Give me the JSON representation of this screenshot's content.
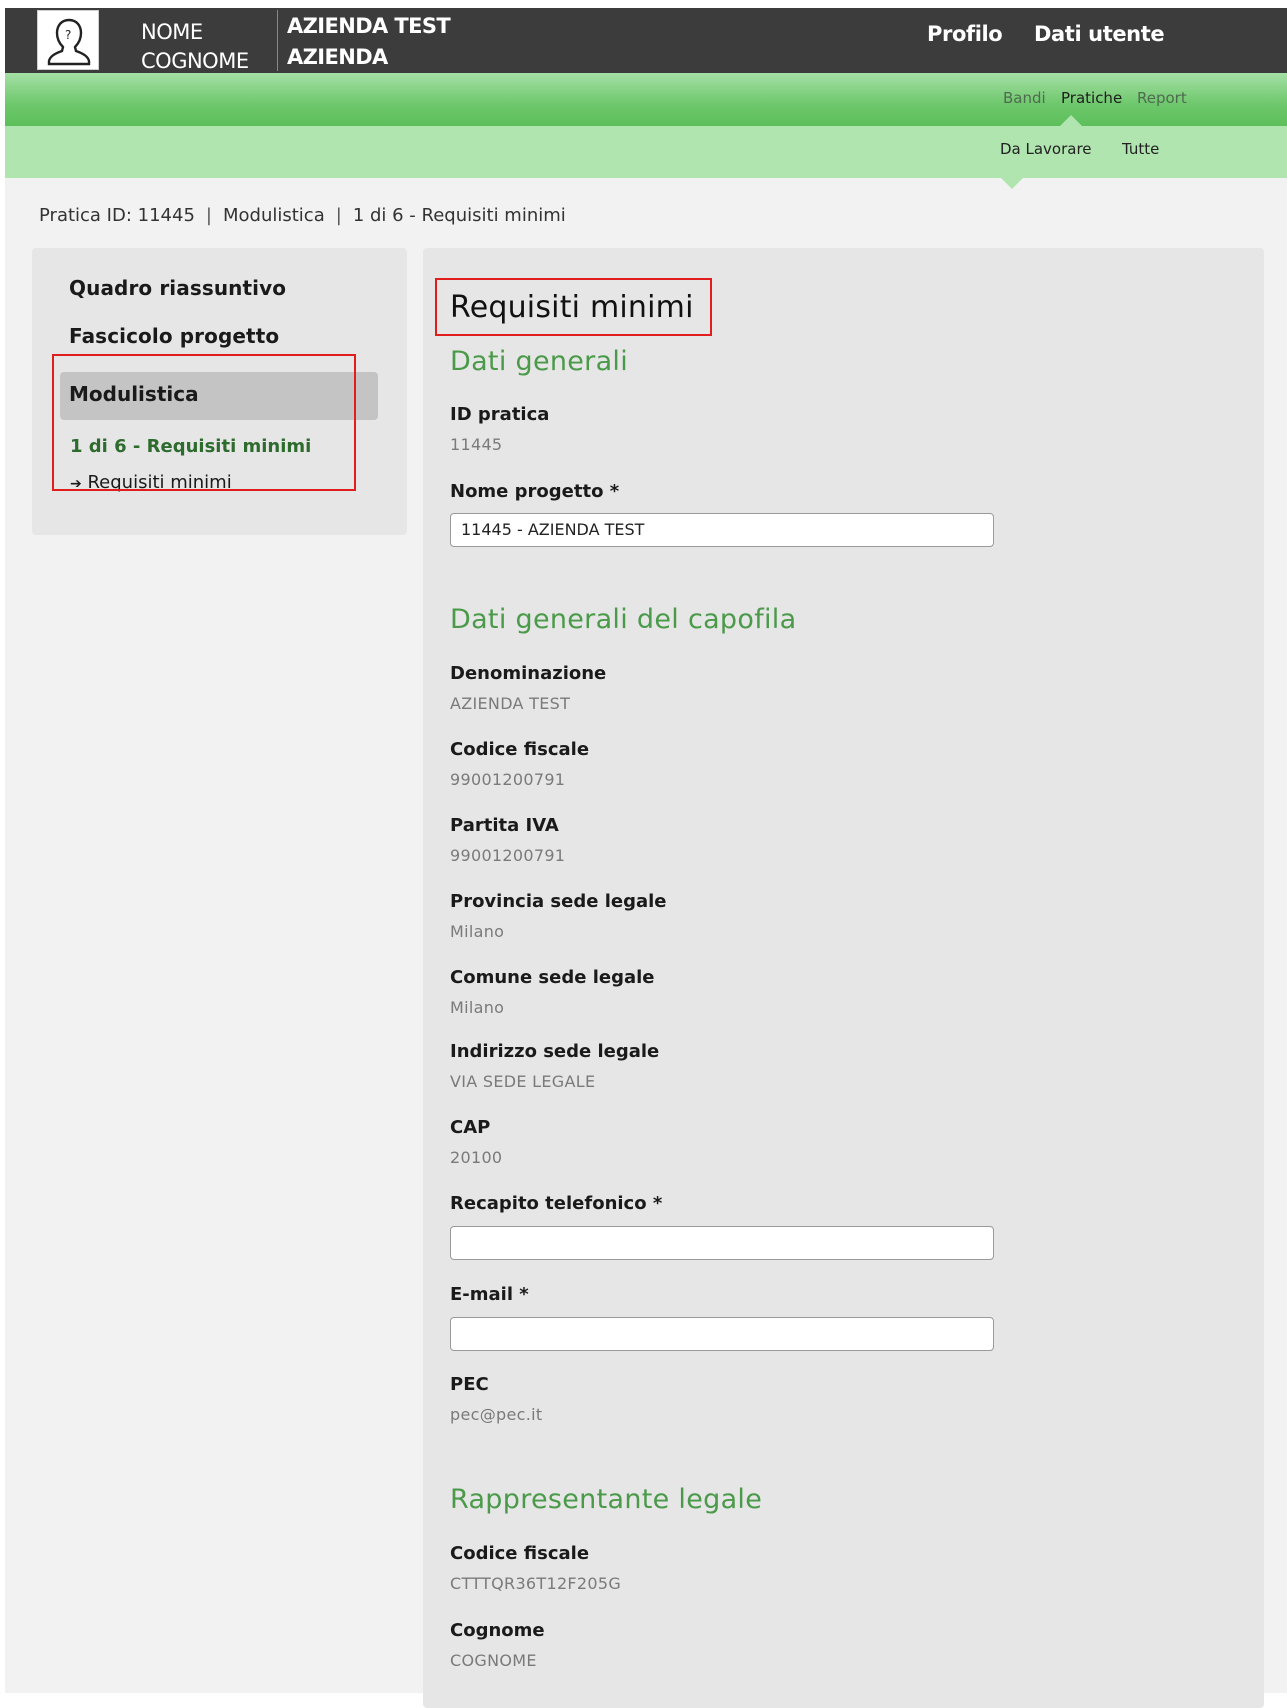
{
  "header": {
    "user_first": "NOME",
    "user_last": "COGNOME",
    "company_line1": "AZIENDA TEST",
    "company_line2": "AZIENDA",
    "profilo": "Profilo",
    "dati_utente": "Dati utente"
  },
  "nav": {
    "primary": [
      "Bandi",
      "Pratiche",
      "Report"
    ],
    "primary_active": "Pratiche",
    "secondary": [
      "Da Lavorare",
      "Tutte"
    ]
  },
  "breadcrumb": {
    "items": [
      "Pratica ID: 11445",
      "Modulistica",
      "1 di 6 - Requisiti minimi"
    ],
    "separator": "|"
  },
  "sidebar": {
    "items": [
      "Quadro riassuntivo",
      "Fascicolo progetto",
      "Modulistica"
    ],
    "active": "Modulistica",
    "sub_step": "1 di 6 - Requisiti minimi",
    "sub_item_arrow": "➔",
    "sub_item": "Requisiti minimi"
  },
  "main": {
    "title": "Requisiti minimi",
    "sections": {
      "dati_generali": "Dati generali",
      "capofila": "Dati generali del capofila",
      "rappresentante": "Rappresentante legale"
    },
    "fields": {
      "id_pratica_label": "ID pratica",
      "id_pratica_value": "11445",
      "nome_progetto_label": "Nome progetto *",
      "nome_progetto_value": "11445 - AZIENDA TEST",
      "denominazione_label": "Denominazione",
      "denominazione_value": "AZIENDA TEST",
      "codice_fiscale_label": "Codice fiscale",
      "codice_fiscale_value": "99001200791",
      "partita_iva_label": "Partita IVA",
      "partita_iva_value": "99001200791",
      "provincia_label": "Provincia sede legale",
      "provincia_value": "Milano",
      "comune_label": "Comune sede legale",
      "comune_value": "Milano",
      "indirizzo_label": "Indirizzo sede legale",
      "indirizzo_value": "VIA SEDE LEGALE",
      "cap_label": "CAP",
      "cap_value": "20100",
      "telefono_label": "Recapito telefonico *",
      "telefono_value": "",
      "email_label": "E-mail *",
      "email_value": "",
      "pec_label": "PEC",
      "pec_value": "pec@pec.it",
      "rl_codice_fiscale_label": "Codice fiscale",
      "rl_codice_fiscale_value": "CTTTQR36T12F205G",
      "rl_cognome_label": "Cognome",
      "rl_cognome_value": "COGNOME"
    }
  },
  "colors": {
    "topbar": "#3c3c3c",
    "nav_green": "#6dc76b",
    "nav_light": "#b0e5b0",
    "section_green": "#4a9a4a",
    "highlight_red": "#e11d1d"
  }
}
